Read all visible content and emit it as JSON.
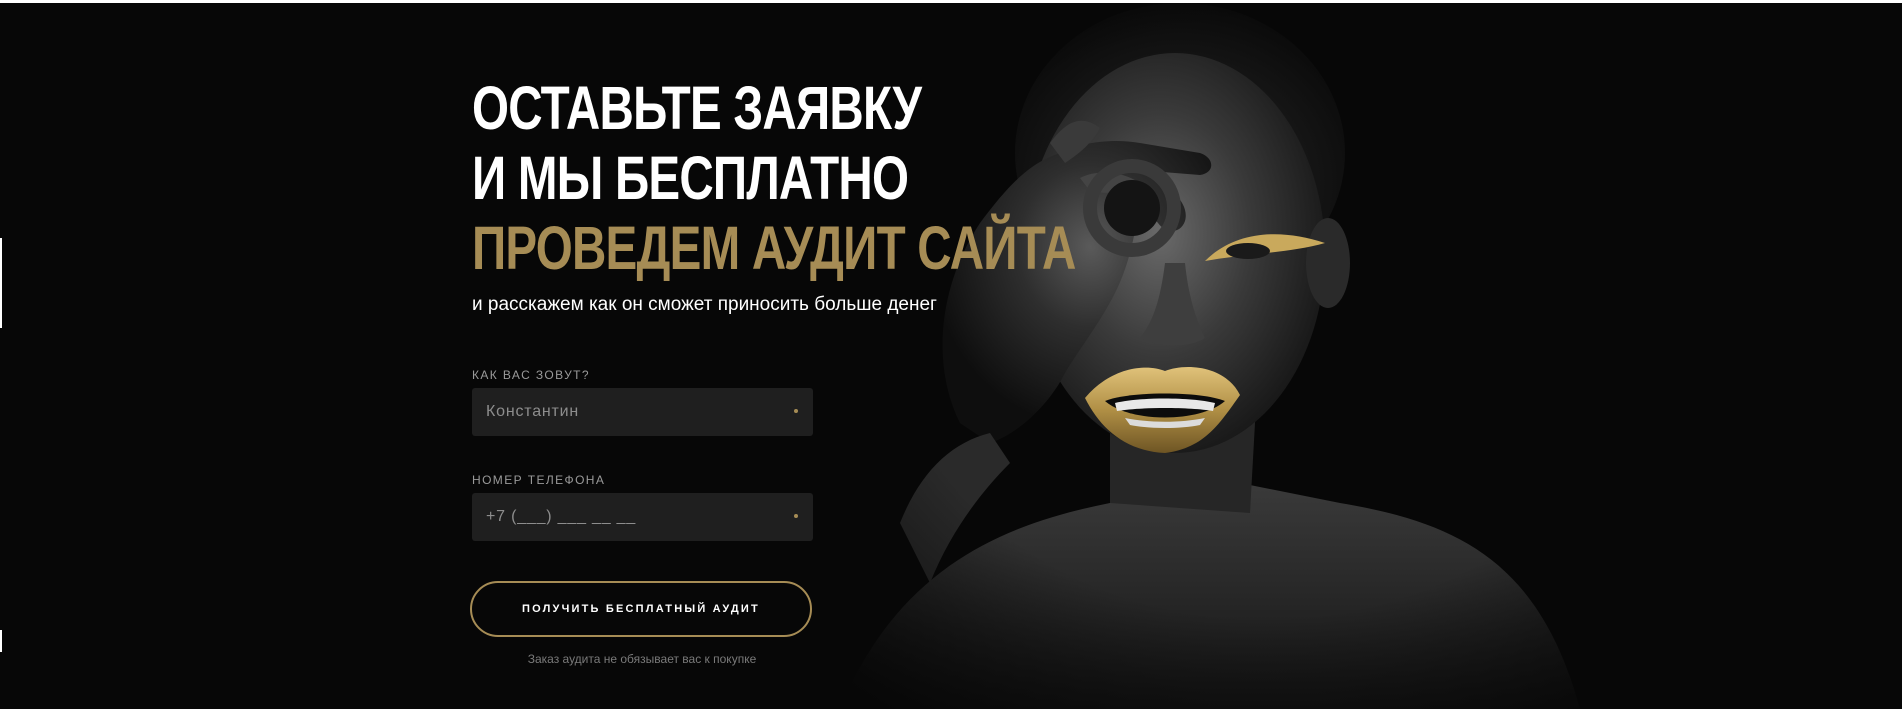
{
  "hero": {
    "headline": {
      "line1": "ОСТАВЬТЕ ЗАЯВКУ",
      "line2": "И МЫ БЕСПЛАТНО",
      "line3": "ПРОВЕДЕМ АУДИТ САЙТА"
    },
    "subtitle": "и расскажем как он сможет приносить больше денег"
  },
  "form": {
    "name_field": {
      "label": "КАК ВАС ЗОВУТ?",
      "placeholder": "Константин",
      "required": true
    },
    "phone_field": {
      "label": "НОМЕР ТЕЛЕФОНА",
      "placeholder": "+7 (___) ___ __ __",
      "required": true
    },
    "submit_label": "ПОЛУЧИТЬ БЕСПЛАТНЫЙ АУДИТ",
    "note": "Заказ аудита не обязывает вас к покупке"
  },
  "theme": {
    "background": "#070707",
    "accent_gold": "#a68c55",
    "field_background": "#1f1f1f",
    "text": "#ffffff"
  },
  "image": {
    "description_icon": "model-photo"
  }
}
